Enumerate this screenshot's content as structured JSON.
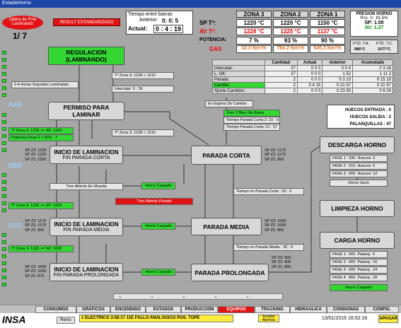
{
  "window": {
    "title": "EstadoHorno"
  },
  "header": {
    "mode_line1": "Opera de Fine",
    "mode_line2": "Laminando",
    "counter": "1/ 7",
    "alarm": "RESULT ESTANDARIZADO",
    "time_title": "Tiempo entre barras",
    "time_prev_label": "Anterior:",
    "time_prev": "0: 0: 5",
    "time_curr_label": "Actual:",
    "time_curr": "0 : 4 : 19"
  },
  "zones": {
    "headers": [
      "ZONA 3",
      "ZONA 2",
      "ZONA 1"
    ],
    "rows": [
      {
        "label": "SP Tª:",
        "values": [
          "1220 °C",
          "1220 °C",
          "1150 °C"
        ]
      },
      {
        "label": "AV Tª:",
        "values": [
          "1228 °C",
          "1225 °C",
          "1137 °C"
        ]
      },
      {
        "label": "POTENCIA:",
        "values": [
          "7 %",
          "93 %",
          "90 %"
        ]
      },
      {
        "label": "GAS",
        "values": [
          "32.3 Nm³/h",
          "784.2 Nm³/h",
          "545.3 Nm³/h"
        ]
      }
    ]
  },
  "pressure": {
    "title": "PRESION HORNO",
    "pos": "Pos. V.: 81.5%",
    "sp": "SP: 1.00",
    "av": "AV: 1.27",
    "ftd_ta_label": "FTD. T.A.",
    "ftd_ta": "986°C",
    "ftd_tc_label": "FTD. T.C.",
    "ftd_tc": "1077°C"
  },
  "stats": {
    "headers": [
      "",
      "Cantidad",
      "Actual",
      "Anterior",
      "Acumulado"
    ],
    "rows": [
      [
        "Intercalar:",
        "37",
        "0 0 0",
        "0 0 4",
        "0 3 16"
      ],
      [
        "L. OK:",
        "37",
        "0 0 0",
        "1 52",
        "1 11 2"
      ],
      [
        "Parada:",
        "2",
        "0 0 0",
        "0 3 10",
        "0 15 19"
      ],
      [
        "Cambio:",
        "2",
        "0 4 15",
        "0 21 57",
        "0 21 57"
      ],
      [
        "Ajuste Cambios:",
        "2",
        "0 0 0",
        "0 23 30",
        "0 6 24"
      ]
    ]
  },
  "flow": {
    "regulacion": [
      "REGULACION",
      "(LAMINANDO)"
    ],
    "zona3_a": "Tª Zona 3: 1228 > 1210",
    "intercalar": "Intercalar: 5 : 30",
    "horas": "0-4 Horas Seguidas Laminadas",
    "permiso": [
      "PERMISO PARA",
      "LAMINAR"
    ],
    "en_espera": "En Espera De Cambio",
    "zona3_b": "Tª Zona 3: 1228 < 1210",
    "tren_vacio": "Tren Y Bien Sin Barra",
    "t_corta2": "Tiempo Parada Corta 2:    10 : 0",
    "t_corta1": "Tiempo Parada Corta:    21 : 57",
    "left_a1": "Tª Zona 3: 1228 >= SP: 1220",
    "left_a2": "Potencia Zona 3 < 20% : 7",
    "inicio1": [
      "INICIO DE LAMINACION",
      "FIN PARADA CORTA"
    ],
    "sp1": [
      "SP Z3: 1220",
      "SP Z2: 1220",
      "SP Z1: 1150"
    ],
    "parada_corta": "PARADA CORTA",
    "sp_pc": [
      "SP Z3: 1170",
      "SP Z2: 1170",
      "SP Z1: 950"
    ],
    "tren_abierto": "Tren Abierto En Muesla",
    "horno_cargado1": "Horno Cargado",
    "tiempo_corta": "Tiempo en Parada Corta : 20 : 0",
    "tren_alarma": "Tren Abierto Parada",
    "left_b": "Tª Zona 3: 1228 >= SP: 1150",
    "inicio2": [
      "INICIO DE LAMINACION",
      "FIN PARADA MEDIA"
    ],
    "sp2": [
      "SP Z3: 1170",
      "SP Z2: 1170",
      "SP Z1: 950"
    ],
    "horno_cargado2": "Horno Cargado",
    "parada_media": "PARADA MEDIA",
    "sp_pm": [
      "SP Z3: 1000",
      "SP Z2: 1000",
      "SP Z1: 800"
    ],
    "tiempo_media": "Tiempo en Parada Media : 30 : 0",
    "left_c": "Tª Zona 3: 1228 >= SP: 1000",
    "inicio3": [
      "INICIO DE LAMINACION",
      "FIN PARADA PROLONGADA"
    ],
    "sp3": [
      "SP Z3: 1000",
      "SP Z2: 1000",
      "SP Z1: 875"
    ],
    "horno_cargado3": "Horno Cargado",
    "parada_prolongada": "PARADA PROLONGADA",
    "sp_pp": [
      "SP Z3: 900",
      "SP Z2: 900",
      "SP Z1: 800"
    ],
    "groups": [
      "AAA",
      "BBB",
      "CCC"
    ]
  },
  "right": {
    "huecos_entrada": "HUECOS ENTRADA :  0",
    "huecos_salida": "HUECOS SALIDA :  2",
    "palanquillas": "PALANQUILLAS :  47",
    "descarga": "DESCARGA HORNO",
    "descarga_fases": [
      [
        "FASE 1 : 930",
        "Huecos: 3"
      ],
      [
        "FASE 2 : 910",
        "Huecos: 6"
      ],
      [
        "FASE 3 : 905",
        "Huecos: 12"
      ]
    ],
    "horno_vacio": "Horno Vacio",
    "limpieza": "LIMPIEZA HORNO",
    "carga": "CARGA HORNO",
    "carga_fases": [
      [
        "FASE 1 : 965",
        "Palanq.: 5"
      ],
      [
        "FASE 2 : 960",
        "Palanq.: 16"
      ],
      [
        "FASE 3 : 900",
        "Palanq.: 24"
      ],
      [
        "FASE 4 : 860",
        "Palanq.: 39"
      ]
    ],
    "horno_cargado": "Horno Cargado"
  },
  "tabs": [
    "CONSUMOS",
    "GRÁFICOS",
    "ENCENDIDO",
    "ESTADOS",
    "PRODUCCIÓN",
    "EQUIPOS",
    "TRACKING",
    "HIDRAULICA",
    "CONSIGNAS",
    "CONFIG."
  ],
  "status": {
    "logo": "INSA",
    "user": "Rems",
    "message": "1 ELECTRICO   3:58:17  11E FALLO ANALOGICO POS. TOPE",
    "ack": "Aceptar Alarmas",
    "datetime": "13/01/2015  16:02:16",
    "apagar": "APAGAR"
  }
}
